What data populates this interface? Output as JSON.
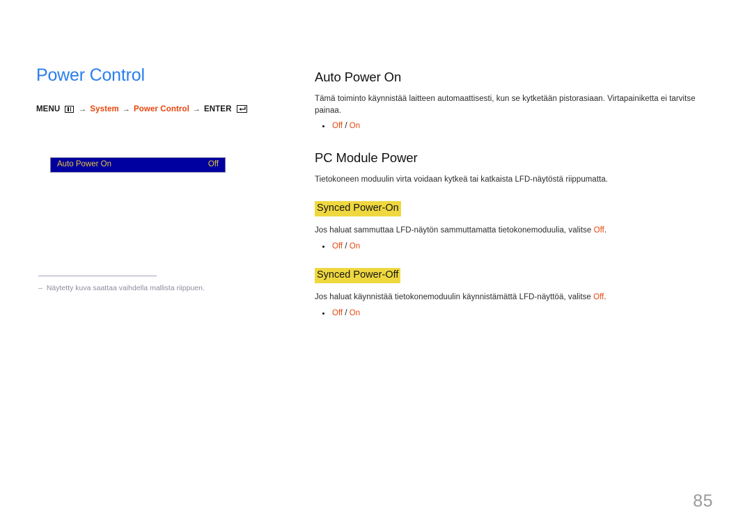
{
  "document": {
    "page_number": "85",
    "colors": {
      "title_blue": "#2a7fec",
      "accent_orange": "#e8450c",
      "highlight_yellow": "#efd83f",
      "osd_background": "#0000a0",
      "osd_text": "#e8c63a",
      "footnote_gray": "#8d8d9e",
      "page_number_gray": "#9a9a9a"
    }
  },
  "left": {
    "title": "Power Control",
    "menu_path": {
      "menu_label": "MENU",
      "menu_icon": "menu-grid-icon",
      "arrow": "→",
      "step1": "System",
      "step2": "Power Control",
      "enter_label": "ENTER",
      "enter_icon": "enter-key-icon"
    },
    "osd": {
      "label": "Auto Power On",
      "value": "Off"
    },
    "footnote": {
      "dash": "‒",
      "text": "Näytetty kuva saattaa vaihdella mallista riippuen."
    }
  },
  "right": {
    "sections": [
      {
        "heading": "Auto Power On",
        "body": "Tämä toiminto käynnistää laitteen automaattisesti, kun se kytketään pistorasiaan. Virtapainiketta ei tarvitse painaa.",
        "options": {
          "off": "Off",
          "sep": "/",
          "on": "On"
        }
      },
      {
        "heading": "PC Module Power",
        "body": "Tietokoneen moduulin virta voidaan kytkeä tai katkaista LFD-näytöstä riippumatta."
      }
    ],
    "sub_sections": [
      {
        "heading": "Synced Power-On",
        "body_before": "Jos haluat sammuttaa LFD-näytön sammuttamatta tietokonemoduulia, valitse ",
        "body_accent": "Off",
        "body_after": ".",
        "options": {
          "off": "Off",
          "sep": "/",
          "on": "On"
        }
      },
      {
        "heading": "Synced Power-Off",
        "body_before": "Jos haluat käynnistää tietokonemoduulin käynnistämättä LFD-näyttöä, valitse ",
        "body_accent": "Off",
        "body_after": ".",
        "options": {
          "off": "Off",
          "sep": "/",
          "on": "On"
        }
      }
    ]
  }
}
